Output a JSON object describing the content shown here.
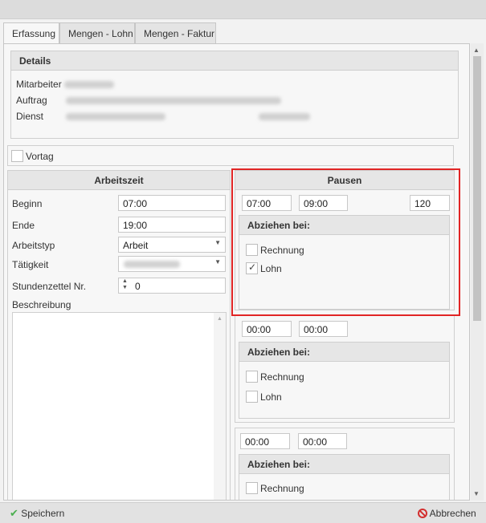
{
  "tabs": [
    "Erfassung",
    "Mengen - Lohn",
    "Mengen - Faktur"
  ],
  "details": {
    "title": "Details",
    "mitarbeiter_label": "Mitarbeiter",
    "auftrag_label": "Auftrag",
    "dienst_label": "Dienst"
  },
  "vortag_label": "Vortag",
  "arbeitszeit": {
    "title": "Arbeitszeit",
    "beginn_label": "Beginn",
    "beginn_value": "07:00",
    "ende_label": "Ende",
    "ende_value": "19:00",
    "arbeitstyp_label": "Arbeitstyp",
    "arbeitstyp_value": "Arbeit",
    "taetigkeit_label": "Tätigkeit",
    "stundenzettel_label": "Stundenzettel Nr.",
    "stundenzettel_value": "0",
    "beschreibung_label": "Beschreibung"
  },
  "pausen": {
    "title": "Pausen",
    "abziehen_label": "Abziehen bei:",
    "rechnung_label": "Rechnung",
    "lohn_label": "Lohn",
    "p1": {
      "from": "07:00",
      "to": "09:00",
      "minutes": "120",
      "rechnung": false,
      "lohn": true
    },
    "p2": {
      "from": "00:00",
      "to": "00:00",
      "rechnung": false,
      "lohn": false
    },
    "p3": {
      "from": "00:00",
      "to": "00:00",
      "rechnung": false
    }
  },
  "footer": {
    "save_label": "Speichern",
    "cancel_label": "Abbrechen"
  },
  "colors": {
    "highlight": "#e12525",
    "save_icon": "#4caf50",
    "cancel_icon": "#d32f2f"
  }
}
